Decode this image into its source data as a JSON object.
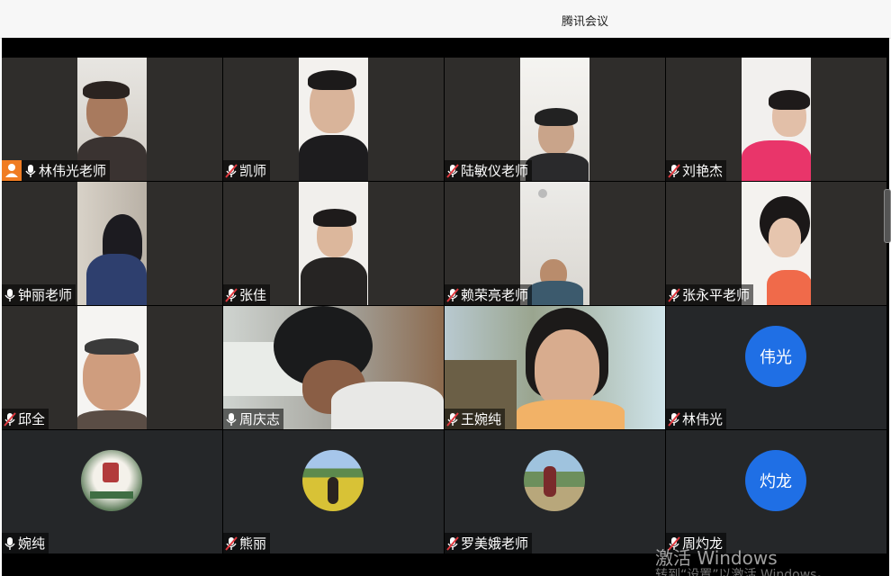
{
  "window": {
    "title": "腾讯会议"
  },
  "participants": [
    {
      "name": "林伟光老师",
      "mic": "on",
      "host": true
    },
    {
      "name": "凯师",
      "mic": "muted"
    },
    {
      "name": "陆敏仪老师",
      "mic": "muted"
    },
    {
      "name": "刘艳杰",
      "mic": "muted"
    },
    {
      "name": "钟丽老师",
      "mic": "on"
    },
    {
      "name": "张佳",
      "mic": "muted"
    },
    {
      "name": "赖荣亮老师",
      "mic": "muted"
    },
    {
      "name": "张永平老师",
      "mic": "muted"
    },
    {
      "name": "邱全",
      "mic": "muted"
    },
    {
      "name": "周庆志",
      "mic": "on"
    },
    {
      "name": "王婉纯",
      "mic": "muted"
    },
    {
      "name": "林伟光",
      "mic": "muted",
      "avatar_text": "伟光"
    },
    {
      "name": "婉纯",
      "mic": "on"
    },
    {
      "name": "熊丽",
      "mic": "muted"
    },
    {
      "name": "罗美娥老师",
      "mic": "muted"
    },
    {
      "name": "周灼龙",
      "mic": "muted",
      "avatar_text": "灼龙"
    }
  ],
  "watermark": {
    "line1": "激活 Windows",
    "line2": "转到“设置”以激活 Windows。"
  },
  "colors": {
    "avatar": "#1f6fe5",
    "host_badge": "#f07c22",
    "muted": "#e0383e"
  }
}
